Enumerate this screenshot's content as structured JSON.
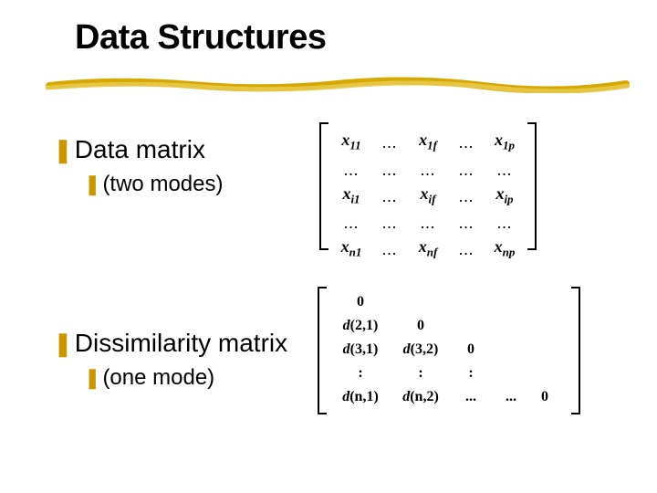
{
  "title": "Data Structures",
  "items": [
    {
      "label": "Data matrix",
      "sub": "(two modes)"
    },
    {
      "label": "Dissimilarity matrix",
      "sub": "(one mode)"
    }
  ],
  "matrix1": {
    "rows": [
      [
        "x_11",
        "...",
        "x_1f",
        "...",
        "x_1p"
      ],
      [
        "...",
        "...",
        "...",
        "...",
        "..."
      ],
      [
        "x_i1",
        "...",
        "x_if",
        "...",
        "x_ip"
      ],
      [
        "...",
        "...",
        "...",
        "...",
        "..."
      ],
      [
        "x_n1",
        "...",
        "x_nf",
        "...",
        "x_np"
      ]
    ]
  },
  "matrix2": {
    "rows": [
      [
        "0",
        "",
        "",
        "",
        ""
      ],
      [
        "d(2,1)",
        "0",
        "",
        "",
        ""
      ],
      [
        "d(3,1)",
        "d(3,2)",
        "0",
        "",
        ""
      ],
      [
        ":",
        ":",
        ":",
        "",
        ""
      ],
      [
        "d(n,1)",
        "d(n,2)",
        "...",
        "...",
        "0"
      ]
    ]
  },
  "bullets": {
    "z": "❚",
    "y": "❚"
  }
}
